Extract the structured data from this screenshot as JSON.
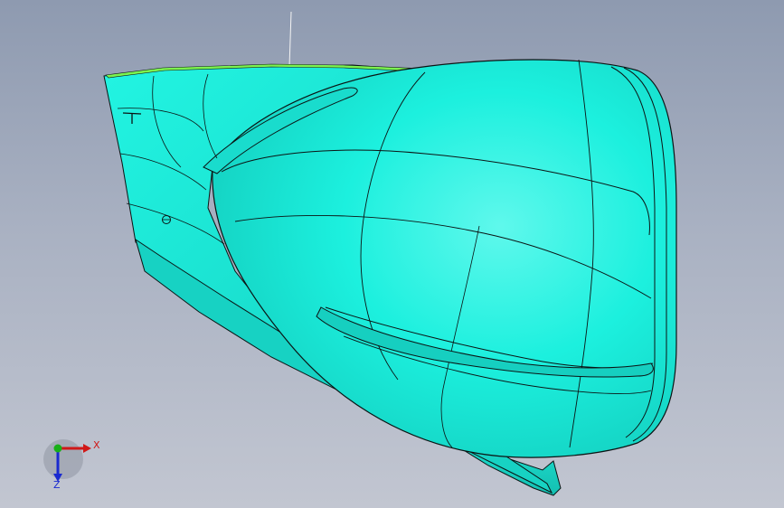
{
  "viewport": {
    "background_top": "#8e9ab0",
    "background_bottom": "#c2c6d1"
  },
  "model": {
    "description_icon": "cad-hull-model",
    "surface_color": "#1cf2e0",
    "edge_color": "#0b1414",
    "highlight_color": "#7cf34f"
  },
  "triad": {
    "x_label": "X",
    "z_label": "Z",
    "x_color": "#d01818",
    "y_color": "#18b018",
    "z_color": "#1a2ad0"
  }
}
